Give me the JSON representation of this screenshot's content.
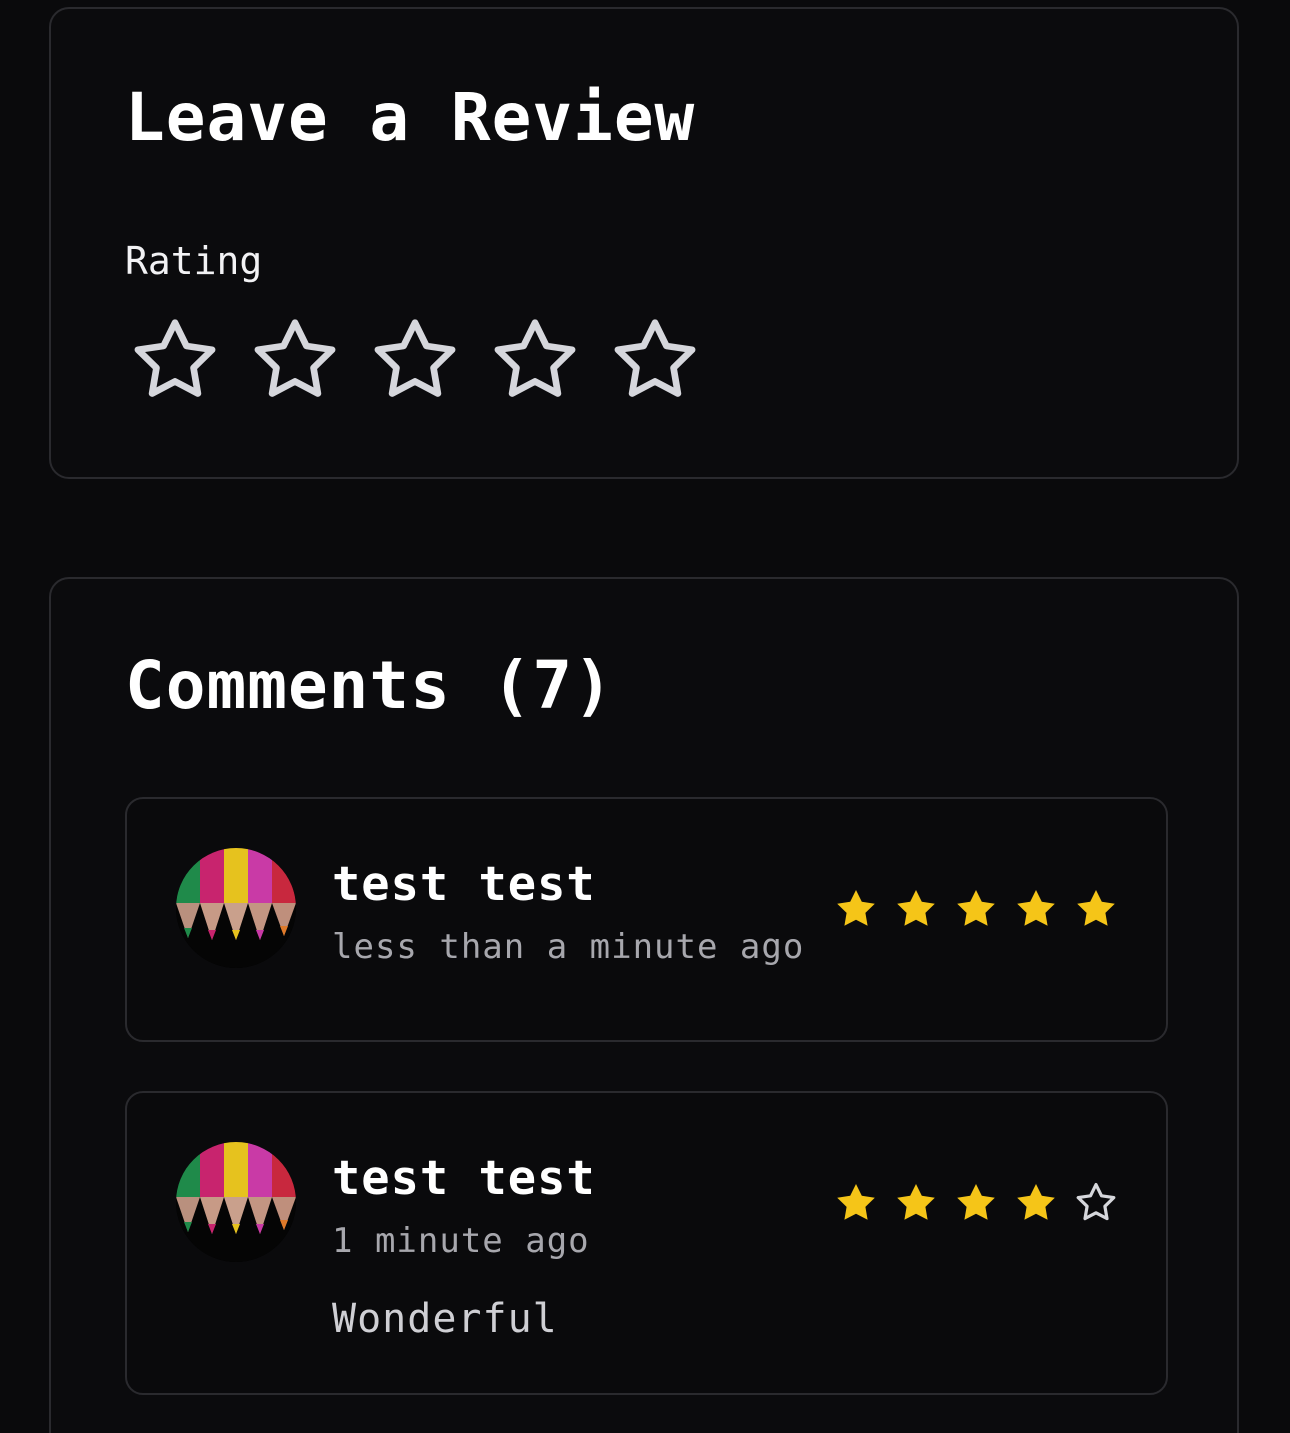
{
  "review_form": {
    "title": "Leave a Review",
    "rating_label": "Rating",
    "rating_value": 0,
    "max_rating": 5
  },
  "comments": {
    "title": "Comments (7)",
    "items": [
      {
        "author": "test test",
        "timestamp": "less than a minute ago",
        "rating": 5,
        "max_rating": 5,
        "body": ""
      },
      {
        "author": "test test",
        "timestamp": "1 minute ago",
        "rating": 4,
        "max_rating": 5,
        "body": "Wonderful"
      }
    ]
  },
  "colors": {
    "star_filled": "#f5c518",
    "star_empty_outline": "#d6d7dc"
  },
  "icons": {
    "rating_star": "star-outline-icon",
    "filled_star": "star-filled-icon",
    "avatar": "colored-pencils-avatar"
  }
}
